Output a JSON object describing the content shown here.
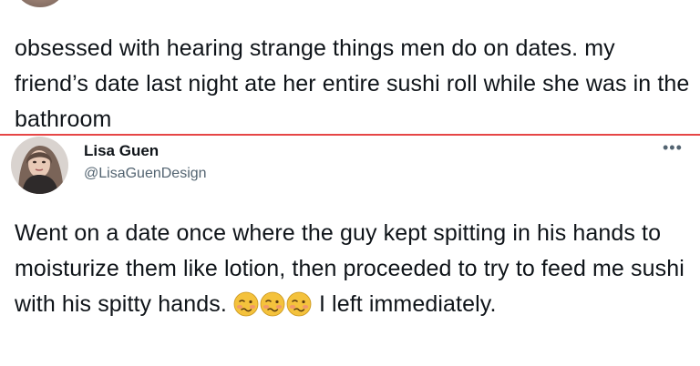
{
  "quoted_tweet": {
    "text": "obsessed with hearing strange things men do on dates. my friend’s date last night ate her entire sushi roll while she was in the bathroom"
  },
  "reply_tweet": {
    "display_name": "Lisa Guen",
    "handle": "@LisaGuenDesign",
    "more_icon": "more-horizontal-icon",
    "text_before_emoji": "Went on a date once where the guy kept spitting in his hands to moisturize them like lotion, then proceeded to try to feed me sushi with his spitty hands. ",
    "emoji_icon": "woozy-face-icon",
    "emoji_count": 3,
    "text_after_emoji": " I left immediately."
  },
  "colors": {
    "divider": "#e64646",
    "secondary_text": "#536471",
    "emoji_face": "#f4c23c"
  }
}
